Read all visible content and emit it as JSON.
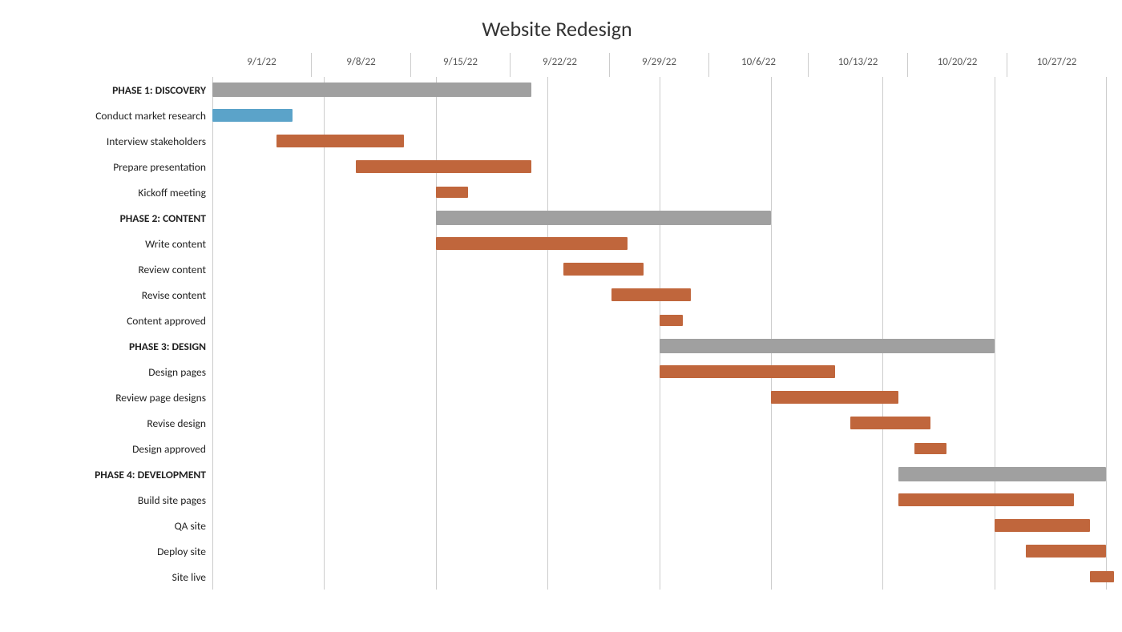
{
  "title": "Website Redesign",
  "dateLabels": [
    "9/1/22",
    "9/8/22",
    "9/15/22",
    "9/22/22",
    "9/29/22",
    "10/6/22",
    "10/13/22",
    "10/20/22",
    "10/27/22"
  ],
  "numCols": 9,
  "totalDays": 56,
  "startDate": "2022-09-01",
  "rows": [
    {
      "label": "PHASE 1: DISCOVERY",
      "phase": true,
      "type": "phase",
      "startDay": 0,
      "durationDays": 20
    },
    {
      "label": "Conduct market research",
      "phase": false,
      "type": "blue",
      "startDay": 0,
      "durationDays": 5
    },
    {
      "label": "Interview stakeholders",
      "phase": false,
      "type": "task",
      "startDay": 4,
      "durationDays": 8
    },
    {
      "label": "Prepare presentation",
      "phase": false,
      "type": "task",
      "startDay": 9,
      "durationDays": 11
    },
    {
      "label": "Kickoff meeting",
      "phase": false,
      "type": "milestone",
      "startDay": 14,
      "durationDays": 2
    },
    {
      "label": "PHASE 2: CONTENT",
      "phase": true,
      "type": "phase",
      "startDay": 14,
      "durationDays": 21
    },
    {
      "label": "Write content",
      "phase": false,
      "type": "task",
      "startDay": 14,
      "durationDays": 12
    },
    {
      "label": "Review content",
      "phase": false,
      "type": "task",
      "startDay": 22,
      "durationDays": 5
    },
    {
      "label": "Revise content",
      "phase": false,
      "type": "task",
      "startDay": 25,
      "durationDays": 5
    },
    {
      "label": "Content approved",
      "phase": false,
      "type": "milestone",
      "startDay": 28,
      "durationDays": 1.5
    },
    {
      "label": "PHASE 3: DESIGN",
      "phase": true,
      "type": "phase",
      "startDay": 28,
      "durationDays": 21
    },
    {
      "label": "Design pages",
      "phase": false,
      "type": "task",
      "startDay": 28,
      "durationDays": 11
    },
    {
      "label": "Review page designs",
      "phase": false,
      "type": "task",
      "startDay": 35,
      "durationDays": 8
    },
    {
      "label": "Revise design",
      "phase": false,
      "type": "task",
      "startDay": 40,
      "durationDays": 5
    },
    {
      "label": "Design approved",
      "phase": false,
      "type": "milestone",
      "startDay": 44,
      "durationDays": 2
    },
    {
      "label": "PHASE 4: DEVELOPMENT",
      "phase": true,
      "type": "phase",
      "startDay": 43,
      "durationDays": 13
    },
    {
      "label": "Build site pages",
      "phase": false,
      "type": "task",
      "startDay": 43,
      "durationDays": 11
    },
    {
      "label": "QA site",
      "phase": false,
      "type": "task",
      "startDay": 49,
      "durationDays": 6
    },
    {
      "label": "Deploy site",
      "phase": false,
      "type": "task",
      "startDay": 51,
      "durationDays": 5
    },
    {
      "label": "Site live",
      "phase": false,
      "type": "milestone",
      "startDay": 55,
      "durationDays": 1.5
    }
  ]
}
